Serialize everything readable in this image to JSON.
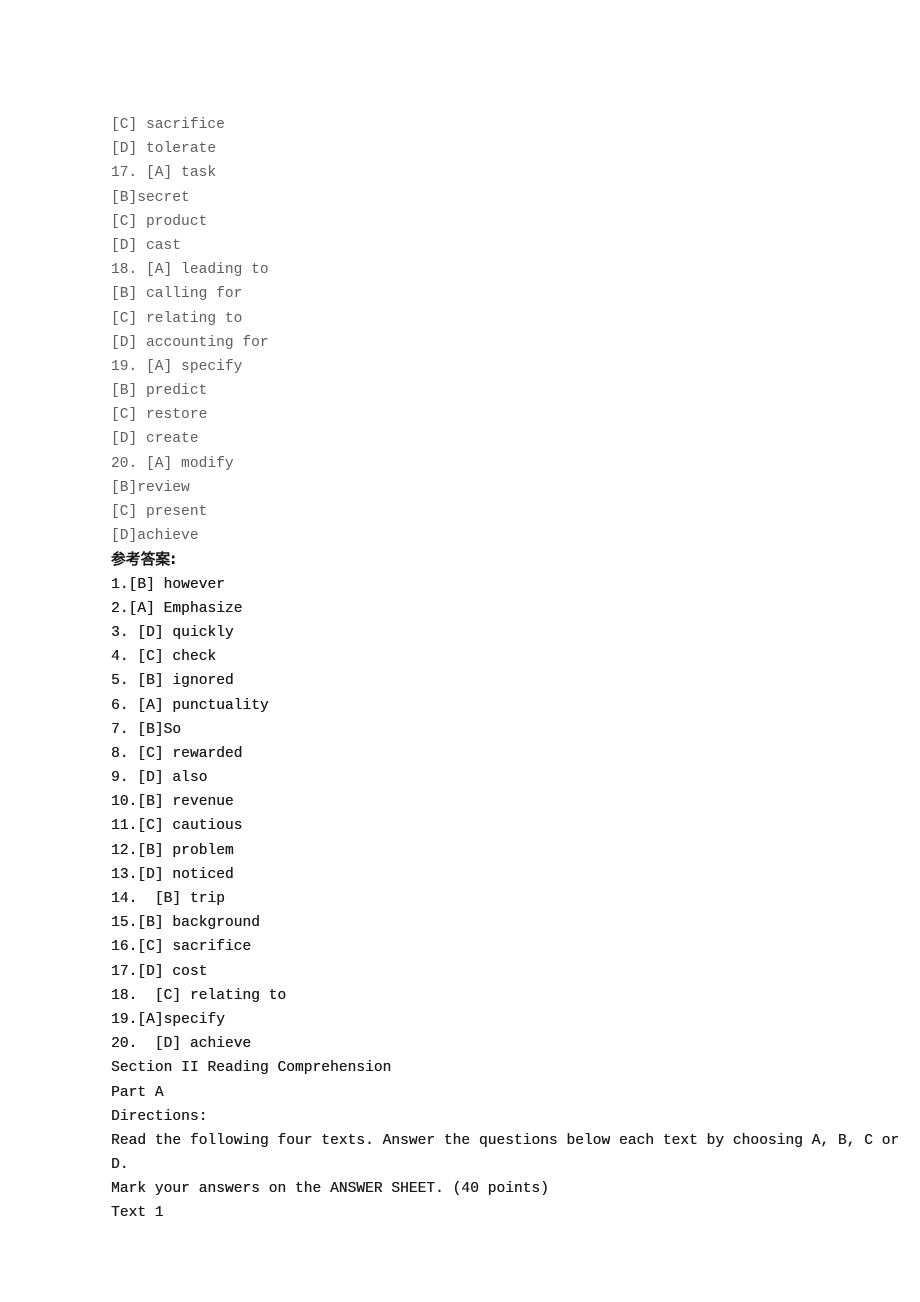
{
  "document": {
    "background_color": "#ffffff",
    "option_text_color": "#5e5e5e",
    "answer_text_color": "#1b1b1b"
  },
  "options_continued": [
    "[C] sacrifice",
    "[D] tolerate",
    "17. [A] task",
    "[B]secret",
    "[C] product",
    "[D] cast",
    "18. [A] leading to",
    "[B] calling for",
    "[C] relating to",
    "[D] accounting for",
    "19. [A] specify",
    "[B] predict",
    "[C] restore",
    "[D] create",
    "20. [A] modify",
    "[B]review",
    "[C] present",
    "[D]achieve"
  ],
  "answer_key": {
    "heading": "参考答案:",
    "items": [
      "1.[B] however",
      "2.[A] Emphasize",
      "3. [D] quickly",
      "4. [C] check",
      "5. [B] ignored",
      "6. [A] punctuality",
      "7. [B]So",
      "8. [C] rewarded",
      "9. [D] also",
      "10.[B] revenue",
      "11.[C] cautious",
      "12.[B] problem",
      "13.[D] noticed",
      "14.  [B] trip",
      "15.[B] background",
      "16.[C] sacrifice",
      "17.[D] cost",
      "18.  [C] relating to",
      "19.[A]specify",
      "20.  [D] achieve"
    ]
  },
  "section": {
    "title": "Section II Reading Comprehension",
    "part": "Part A",
    "directions_label": "Directions:",
    "directions_line1": "Read the following four texts. Answer the questions below each text by choosing A, B, C or",
    "directions_line2": "D.",
    "directions_line3": "Mark your answers on the ANSWER SHEET. (40 points)",
    "text_label": "Text 1"
  }
}
